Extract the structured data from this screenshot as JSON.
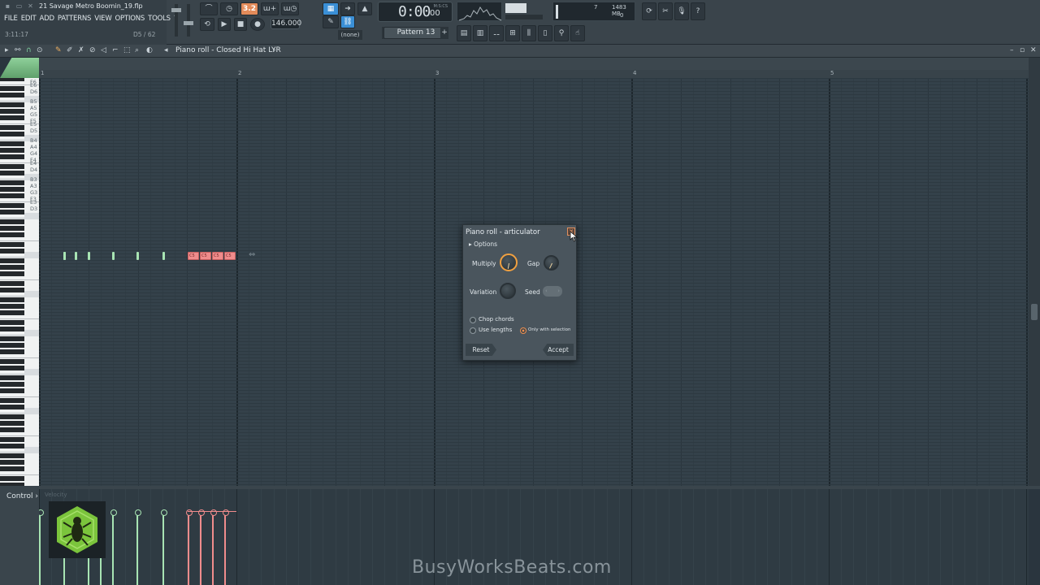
{
  "window": {
    "project_title": "21 Savage Metro Boomin_19.flp",
    "time_display": "3:11:17",
    "selection_count": "D5 / 62"
  },
  "menu": [
    "FILE",
    "EDIT",
    "ADD",
    "PATTERNS",
    "VIEW",
    "OPTIONS",
    "TOOLS",
    "?"
  ],
  "toolbar": {
    "tempo": "146.000",
    "pattern_mode_label": "3.2",
    "transport_time": "0:00",
    "transport_time_small": "00",
    "transport_unit": "M:S:CS",
    "pattern": "Pattern 13",
    "snap": "(none)",
    "cpu_value": "7",
    "memory": "1483 MB",
    "voices": "0"
  },
  "piano_roll": {
    "title": "Piano roll - Closed Hi Hat LYR",
    "bar_numbers": [
      "1",
      "2",
      "3",
      "4",
      "5"
    ],
    "key_labels": [
      "F6",
      "E6",
      "D6",
      "C6",
      "B5",
      "A5",
      "G5",
      "F5",
      "E5",
      "D5",
      "C5",
      "B4",
      "A4",
      "G4",
      "F4",
      "E4",
      "D4",
      "C4",
      "B3",
      "A3",
      "G3",
      "F3",
      "E3",
      "D3"
    ],
    "red_note_label": "C5",
    "control_label": "Control",
    "control_param": "Velocity"
  },
  "articulator": {
    "title": "Piano roll - articulator",
    "options_label": "Options",
    "multiply_label": "Multiply",
    "gap_label": "Gap",
    "variation_label": "Variation",
    "seed_label": "Seed",
    "chop_chords_label": "Chop chords",
    "use_lengths_label": "Use lengths",
    "only_with_selection_label": "Only with selection",
    "reset_label": "Reset",
    "accept_label": "Accept"
  },
  "watermark": "BusyWorksBeats.com",
  "colors": {
    "note_green": "#a8e4b3",
    "note_red": "#f08c8c",
    "accent_orange": "#f0a040",
    "grid_bg": "#34414a"
  }
}
